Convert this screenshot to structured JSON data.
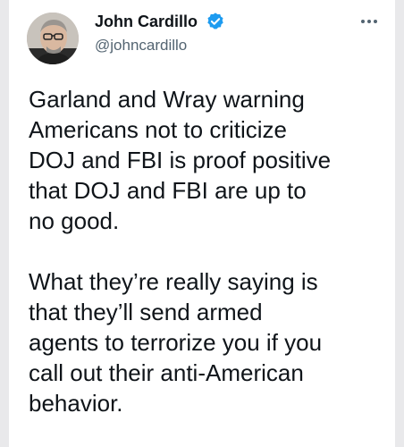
{
  "author": {
    "display_name": "John Cardillo",
    "handle": "@johncardillo",
    "verified": true,
    "avatar_icon": "profile-photo",
    "verified_color": "#1d9bf0"
  },
  "tweet": {
    "paragraph_1": "Garland and Wray warning\nAmericans not to criticize\nDOJ and FBI is proof positive\nthat DOJ and FBI are up to\nno good.",
    "paragraph_2": "What they’re really saying is\nthat they’ll send armed\nagents to terrorize you if you\ncall out their anti-American\nbehavior."
  },
  "menu": {
    "icon": "more-options-icon"
  },
  "colors": {
    "text": "#0f1419",
    "secondary_text": "#536471",
    "background": "#ffffff"
  }
}
